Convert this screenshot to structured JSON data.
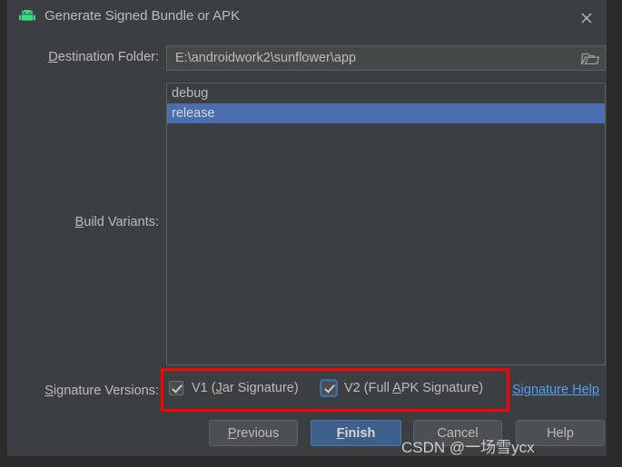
{
  "window": {
    "title": "Generate Signed Bundle or APK",
    "app_icon": "android-robot-icon",
    "close_icon": "close-icon",
    "background_color": "#3c3f41",
    "outer_background_color": "#2b2b2b"
  },
  "destination": {
    "label": "Destination Folder:",
    "label_mnemonic": "D",
    "label_rest": "estination Folder:",
    "value": "E:\\androidwork2\\sunflower\\app",
    "browse_icon": "folder-icon"
  },
  "build_variants": {
    "label": "Build Variants:",
    "label_mnemonic": "B",
    "label_rest": "uild Variants:",
    "items": [
      {
        "label": "debug",
        "selected": false
      },
      {
        "label": "release",
        "selected": true
      }
    ],
    "selection_color": "#4b6eaf"
  },
  "signature_versions": {
    "label": "Signature Versions:",
    "label_mnemonic": "S",
    "label_rest": "ignature Versions:",
    "checkboxes": [
      {
        "prefix": "V1 (",
        "mnemonic": "J",
        "suffix": "ar Signature)",
        "checked": true,
        "focused": false
      },
      {
        "prefix": "V2 (Full ",
        "mnemonic": "A",
        "suffix": "PK Signature)",
        "checked": true,
        "focused": true
      }
    ],
    "help_link": "Signature Help",
    "help_link_color": "#589df6"
  },
  "annotation": {
    "color": "#fe0000",
    "shape": "rectangle"
  },
  "buttons": {
    "previous": {
      "prefix": "",
      "mnemonic": "P",
      "suffix": "revious",
      "primary": false
    },
    "finish": {
      "prefix": "",
      "mnemonic": "F",
      "suffix": "inish",
      "primary": true
    },
    "cancel": {
      "prefix": "Cancel",
      "mnemonic": "",
      "suffix": "",
      "primary": false
    },
    "help": {
      "prefix": "Help",
      "mnemonic": "",
      "suffix": "",
      "primary": false
    }
  },
  "watermark": {
    "text": "CSDN @一场雪ycx"
  }
}
